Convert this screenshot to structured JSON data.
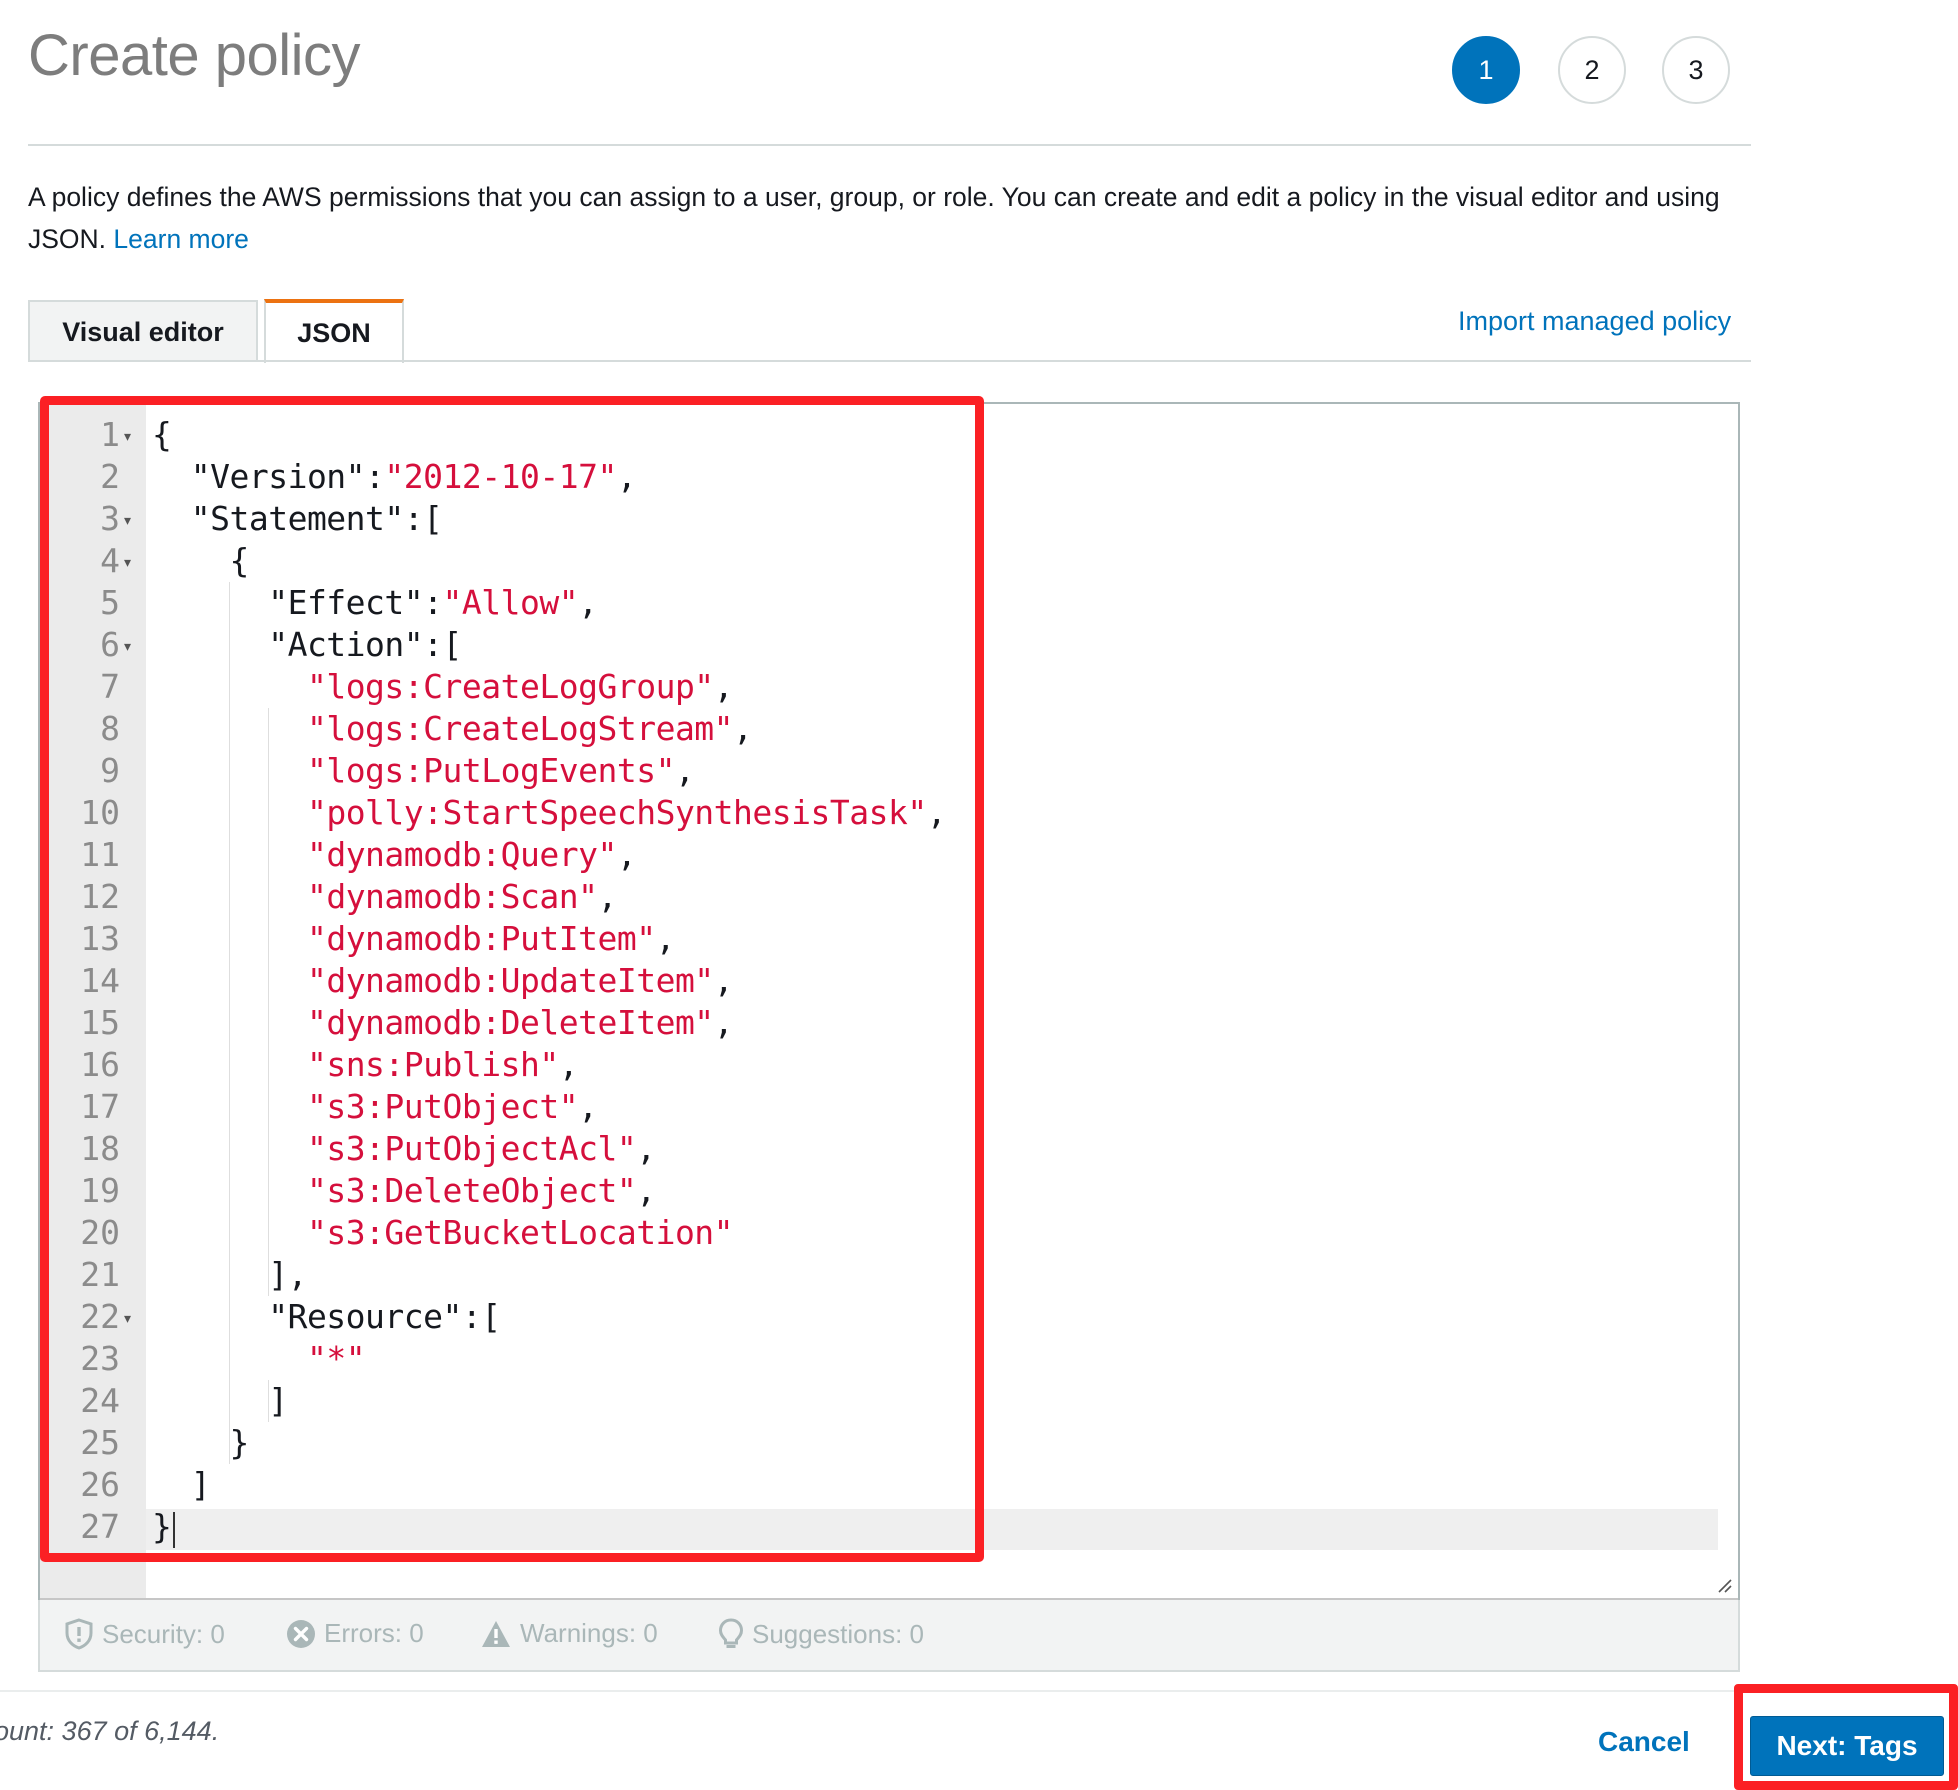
{
  "page": {
    "title": "Create policy"
  },
  "steps": [
    "1",
    "2",
    "3"
  ],
  "description": {
    "text": "A policy defines the AWS permissions that you can assign to a user, group, or role. You can create and edit a policy in the visual editor and using JSON. ",
    "learn_more": "Learn more"
  },
  "tabs": [
    {
      "label": "Visual editor",
      "active": false
    },
    {
      "label": "JSON",
      "active": true
    }
  ],
  "import_link": "Import managed policy",
  "editor": {
    "lines": [
      {
        "num": "1",
        "fold": true,
        "parts": [
          [
            "p",
            "{"
          ]
        ]
      },
      {
        "num": "2",
        "fold": false,
        "parts": [
          [
            "p",
            "  \"Version\":"
          ],
          [
            "s",
            "\"2012-10-17\""
          ],
          [
            "p",
            ","
          ]
        ]
      },
      {
        "num": "3",
        "fold": true,
        "parts": [
          [
            "p",
            "  \"Statement\":["
          ]
        ]
      },
      {
        "num": "4",
        "fold": true,
        "parts": [
          [
            "p",
            "    {"
          ]
        ]
      },
      {
        "num": "5",
        "fold": false,
        "parts": [
          [
            "p",
            "      \"Effect\":"
          ],
          [
            "s",
            "\"Allow\""
          ],
          [
            "p",
            ","
          ]
        ]
      },
      {
        "num": "6",
        "fold": true,
        "parts": [
          [
            "p",
            "      \"Action\":["
          ]
        ]
      },
      {
        "num": "7",
        "fold": false,
        "parts": [
          [
            "p",
            "        "
          ],
          [
            "s",
            "\"logs:CreateLogGroup\""
          ],
          [
            "p",
            ","
          ]
        ]
      },
      {
        "num": "8",
        "fold": false,
        "parts": [
          [
            "p",
            "        "
          ],
          [
            "s",
            "\"logs:CreateLogStream\""
          ],
          [
            "p",
            ","
          ]
        ]
      },
      {
        "num": "9",
        "fold": false,
        "parts": [
          [
            "p",
            "        "
          ],
          [
            "s",
            "\"logs:PutLogEvents\""
          ],
          [
            "p",
            ","
          ]
        ]
      },
      {
        "num": "10",
        "fold": false,
        "parts": [
          [
            "p",
            "        "
          ],
          [
            "s",
            "\"polly:StartSpeechSynthesisTask\""
          ],
          [
            "p",
            ","
          ]
        ]
      },
      {
        "num": "11",
        "fold": false,
        "parts": [
          [
            "p",
            "        "
          ],
          [
            "s",
            "\"dynamodb:Query\""
          ],
          [
            "p",
            ","
          ]
        ]
      },
      {
        "num": "12",
        "fold": false,
        "parts": [
          [
            "p",
            "        "
          ],
          [
            "s",
            "\"dynamodb:Scan\""
          ],
          [
            "p",
            ","
          ]
        ]
      },
      {
        "num": "13",
        "fold": false,
        "parts": [
          [
            "p",
            "        "
          ],
          [
            "s",
            "\"dynamodb:PutItem\""
          ],
          [
            "p",
            ","
          ]
        ]
      },
      {
        "num": "14",
        "fold": false,
        "parts": [
          [
            "p",
            "        "
          ],
          [
            "s",
            "\"dynamodb:UpdateItem\""
          ],
          [
            "p",
            ","
          ]
        ]
      },
      {
        "num": "15",
        "fold": false,
        "parts": [
          [
            "p",
            "        "
          ],
          [
            "s",
            "\"dynamodb:DeleteItem\""
          ],
          [
            "p",
            ","
          ]
        ]
      },
      {
        "num": "16",
        "fold": false,
        "parts": [
          [
            "p",
            "        "
          ],
          [
            "s",
            "\"sns:Publish\""
          ],
          [
            "p",
            ","
          ]
        ]
      },
      {
        "num": "17",
        "fold": false,
        "parts": [
          [
            "p",
            "        "
          ],
          [
            "s",
            "\"s3:PutObject\""
          ],
          [
            "p",
            ","
          ]
        ]
      },
      {
        "num": "18",
        "fold": false,
        "parts": [
          [
            "p",
            "        "
          ],
          [
            "s",
            "\"s3:PutObjectAcl\""
          ],
          [
            "p",
            ","
          ]
        ]
      },
      {
        "num": "19",
        "fold": false,
        "parts": [
          [
            "p",
            "        "
          ],
          [
            "s",
            "\"s3:DeleteObject\""
          ],
          [
            "p",
            ","
          ]
        ]
      },
      {
        "num": "20",
        "fold": false,
        "parts": [
          [
            "p",
            "        "
          ],
          [
            "s",
            "\"s3:GetBucketLocation\""
          ]
        ]
      },
      {
        "num": "21",
        "fold": false,
        "parts": [
          [
            "p",
            "      ],"
          ]
        ]
      },
      {
        "num": "22",
        "fold": true,
        "parts": [
          [
            "p",
            "      \"Resource\":["
          ]
        ]
      },
      {
        "num": "23",
        "fold": false,
        "parts": [
          [
            "p",
            "        "
          ],
          [
            "s",
            "\"*\""
          ]
        ]
      },
      {
        "num": "24",
        "fold": false,
        "parts": [
          [
            "p",
            "      ]"
          ]
        ]
      },
      {
        "num": "25",
        "fold": false,
        "parts": [
          [
            "p",
            "    }"
          ]
        ]
      },
      {
        "num": "26",
        "fold": false,
        "parts": [
          [
            "p",
            "  ]"
          ]
        ]
      },
      {
        "num": "27",
        "fold": false,
        "parts": [
          [
            "p",
            "}"
          ]
        ]
      }
    ]
  },
  "status": {
    "security": "Security: 0",
    "errors": "Errors: 0",
    "warnings": "Warnings: 0",
    "suggestions": "Suggestions: 0"
  },
  "footer": {
    "char_count": "ount: 367 of 6,144.",
    "cancel": "Cancel",
    "next": "Next: Tags"
  },
  "colors": {
    "accent": "#0073bb",
    "string": "#d50f3c",
    "highlight": "#fb2024",
    "active_tab": "#ec7211"
  }
}
